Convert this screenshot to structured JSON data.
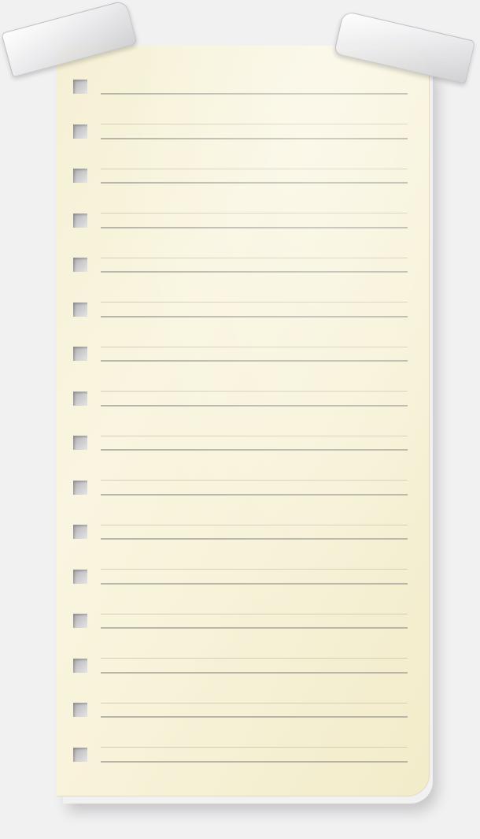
{
  "note": {
    "line_count": 16,
    "paper_color": "#f7f2d8",
    "line_color": "#b8b6a8",
    "hole_color": "#c9c9cb",
    "tape_color": "#e6e6e8"
  }
}
